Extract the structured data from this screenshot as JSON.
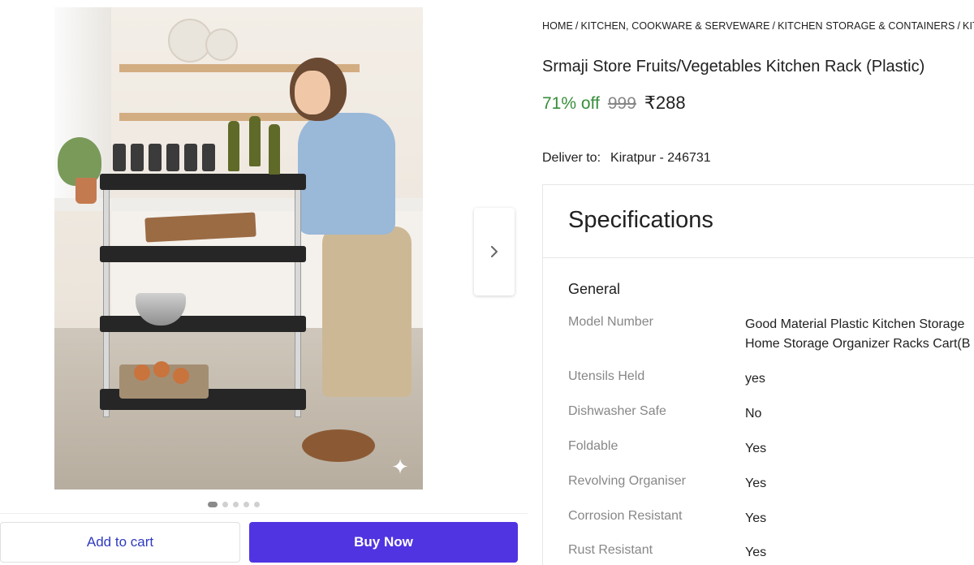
{
  "breadcrumb": [
    "HOME",
    "KITCHEN, COOKWARE & SERVEWARE",
    "KITCHEN STORAGE & CONTAINERS",
    "KITCH"
  ],
  "product": {
    "title": "Srmaji Store Fruits/Vegetables Kitchen Rack (Plastic)",
    "discount": "71% off",
    "mrp": "999",
    "price": "₹288"
  },
  "delivery": {
    "label": "Deliver to:",
    "location": "Kiratpur - 246731"
  },
  "specifications": {
    "heading": "Specifications",
    "group": "General",
    "rows": [
      {
        "key": "Model Number",
        "value_line1": "Good Material Plastic Kitchen Storage",
        "value_line2": "Home Storage Organizer Racks Cart(B"
      },
      {
        "key": "Utensils Held",
        "value_line1": "yes"
      },
      {
        "key": "Dishwasher Safe",
        "value_line1": "No"
      },
      {
        "key": "Foldable",
        "value_line1": "Yes"
      },
      {
        "key": "Revolving Organiser",
        "value_line1": "Yes"
      },
      {
        "key": "Corrosion Resistant",
        "value_line1": "Yes"
      },
      {
        "key": "Rust Resistant",
        "value_line1": "Yes"
      }
    ]
  },
  "carousel": {
    "total_images": 5,
    "active_index": 0
  },
  "actions": {
    "add_to_cart": "Add to cart",
    "buy_now": "Buy Now"
  },
  "colors": {
    "accent": "#5034e2",
    "discount_green": "#388e3c",
    "add_to_cart_text": "#2f3abf"
  },
  "icons": {
    "next": "chevron-right-icon",
    "sparkle": "sparkle-icon"
  }
}
